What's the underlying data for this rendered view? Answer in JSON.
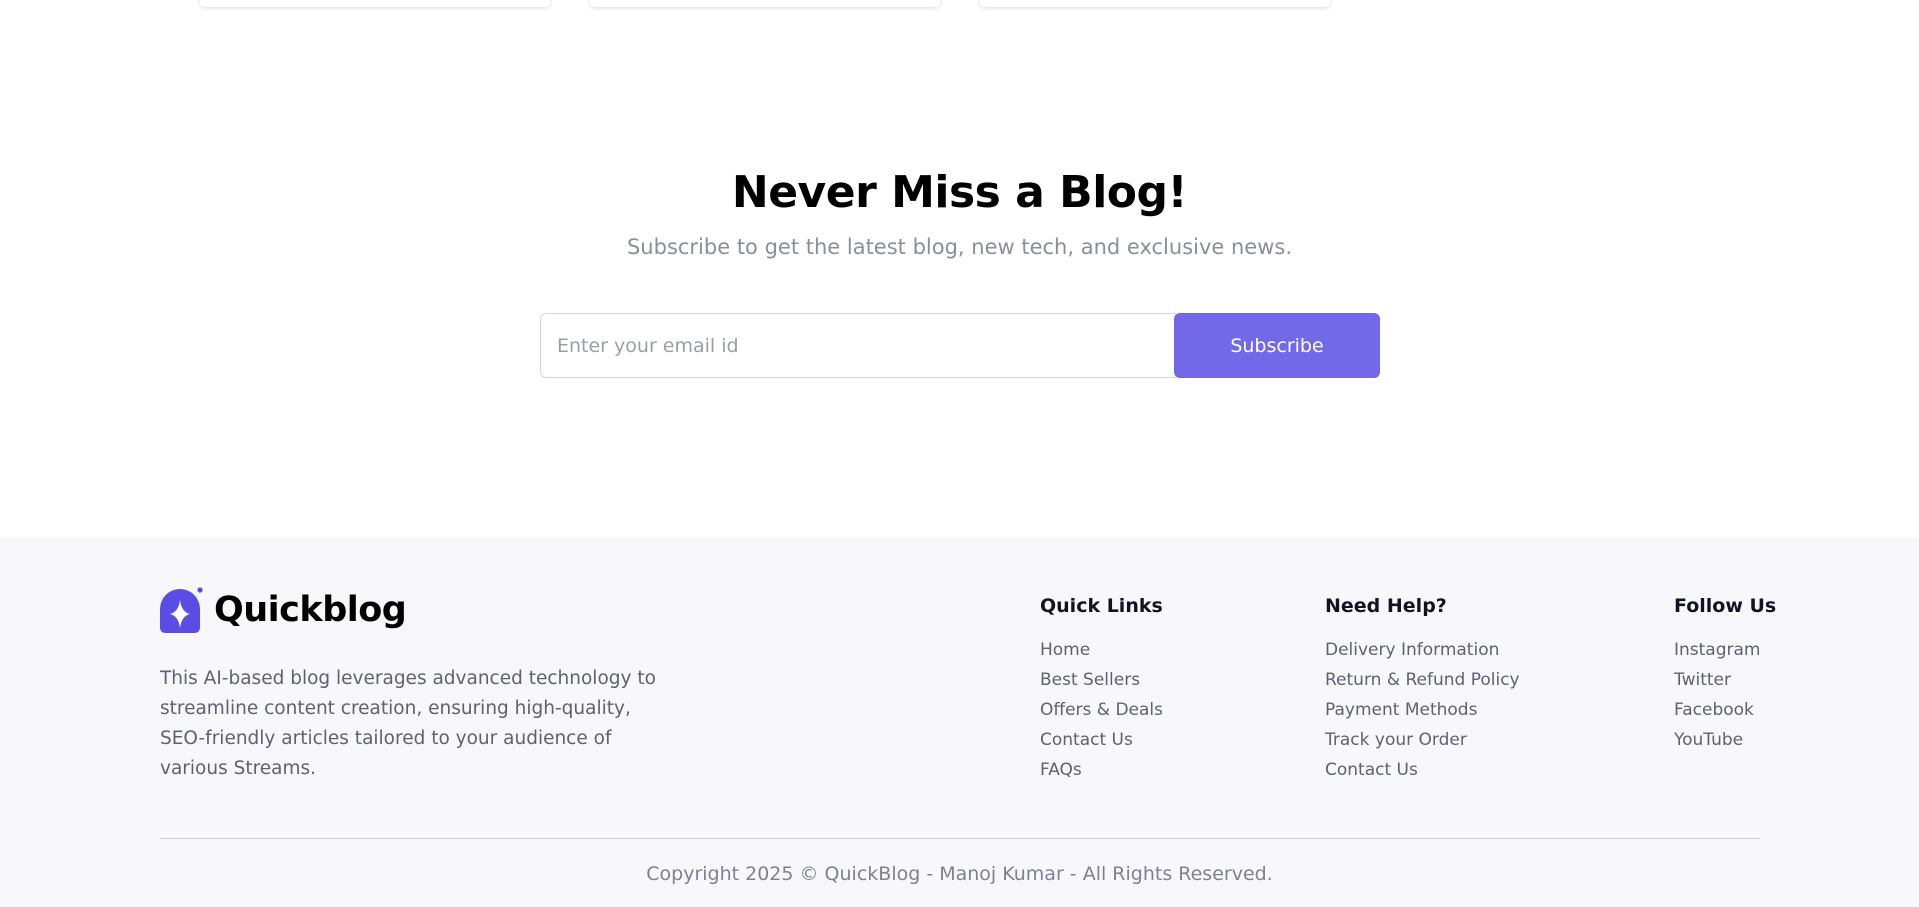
{
  "newsletter": {
    "title": "Never Miss a Blog!",
    "subtitle": "Subscribe to get the latest blog, new tech, and exclusive news.",
    "email_placeholder": "Enter your email id",
    "email_value": "",
    "subscribe_label": "Subscribe"
  },
  "footer": {
    "brand_name": "Quickblog",
    "description": "This AI-based blog leverages advanced technology to streamline content creation, ensuring high-quality, SEO-friendly articles tailored to your audience of various Streams.",
    "quick_links": {
      "heading": "Quick Links",
      "items": [
        "Home",
        "Best Sellers",
        "Offers & Deals",
        "Contact Us",
        "FAQs"
      ]
    },
    "need_help": {
      "heading": "Need Help?",
      "items": [
        "Delivery Information",
        "Return & Refund Policy",
        "Payment Methods",
        "Track your Order",
        "Contact Us"
      ]
    },
    "follow_us": {
      "heading": "Follow Us",
      "items": [
        "Instagram",
        "Twitter",
        "Facebook",
        "YouTube"
      ]
    },
    "copyright": "Copyright 2025 © QuickBlog - Manoj Kumar - All Rights Reserved."
  },
  "colors": {
    "accent": "#7268e8",
    "logo": "#5b4ce6",
    "footer_bg": "#f8f8fc",
    "muted_text": "#5b6271"
  },
  "icons": {
    "brand_logo": "sparkle-star-icon"
  }
}
